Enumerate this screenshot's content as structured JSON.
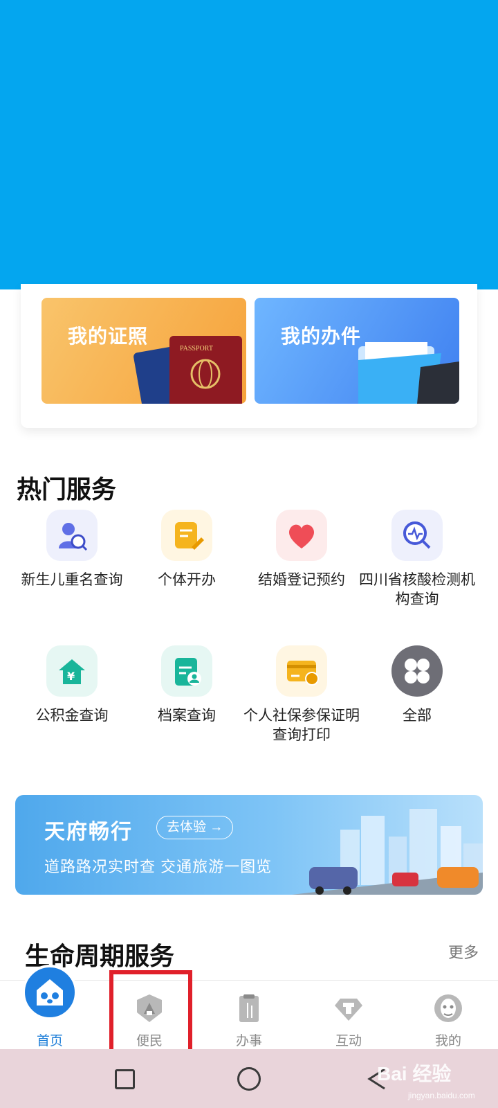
{
  "colors": {
    "hero": "#04a6ef",
    "accent": "#1d7ed8",
    "highlight": "#e0202a"
  },
  "cards": {
    "certificates": "我的证照",
    "cases": "我的办件",
    "passport_text": "PASSPORT"
  },
  "hot_services": {
    "title": "热门服务",
    "items": [
      {
        "label": "新生儿重名查询",
        "icon": "person-search-icon"
      },
      {
        "label": "个体开办",
        "icon": "note-edit-icon"
      },
      {
        "label": "结婚登记预约",
        "icon": "heart-icon"
      },
      {
        "label": "四川省核酸检测机构查询",
        "icon": "pulse-search-icon"
      },
      {
        "label": "公积金查询",
        "icon": "house-yuan-icon"
      },
      {
        "label": "档案查询",
        "icon": "archive-icon"
      },
      {
        "label": "个人社保参保证明查询打印",
        "icon": "card-print-icon"
      },
      {
        "label": "全部",
        "icon": "grid-all-icon"
      }
    ]
  },
  "banner": {
    "title": "天府畅行",
    "button": "去体验 →",
    "subtitle": "道路路况实时查 交通旅游一图览"
  },
  "lifecycle": {
    "title": "生命周期服务",
    "more": "更多"
  },
  "tabs": [
    {
      "label": "首页",
      "icon": "home-icon",
      "active": true
    },
    {
      "label": "便民",
      "icon": "pagoda-badge-icon",
      "active": false
    },
    {
      "label": "办事",
      "icon": "document-bamboo-icon",
      "active": false
    },
    {
      "label": "互动",
      "icon": "gem-hat-icon",
      "active": false
    },
    {
      "label": "我的",
      "icon": "face-icon",
      "active": false
    }
  ],
  "watermark": {
    "brand": "Bai 经验",
    "url": "jingyan.baidu.com"
  }
}
